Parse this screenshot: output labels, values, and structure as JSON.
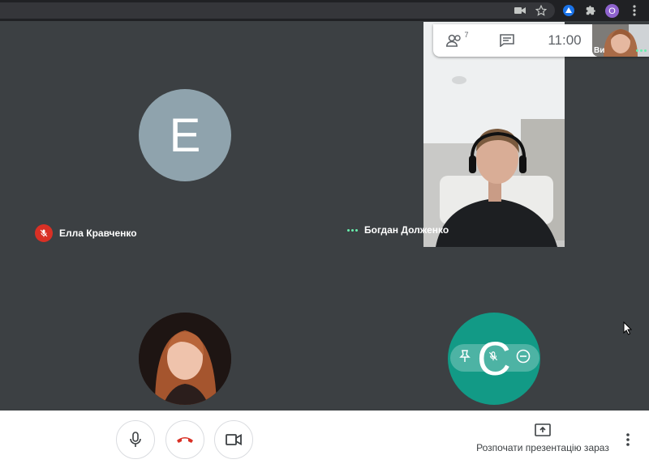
{
  "participants": [
    {
      "name": "Елла Кравченко",
      "initial": "E",
      "muted": true
    },
    {
      "name": "Богдан Долженко",
      "speaking": true
    },
    {
      "name": "",
      "initial": "C",
      "muted": true
    }
  ],
  "info_panel": {
    "people_count": "7",
    "time": "11:00",
    "mini_label": "Ви"
  },
  "controls": {
    "present_label": "Розпочати презентацію зараз"
  },
  "browser": {
    "profile_initial": "O"
  },
  "colors": {
    "avatar_e": "#8fa3ad",
    "avatar_c": "#129a86",
    "hangup": "#d93025",
    "speaking": "#69f0ae"
  }
}
